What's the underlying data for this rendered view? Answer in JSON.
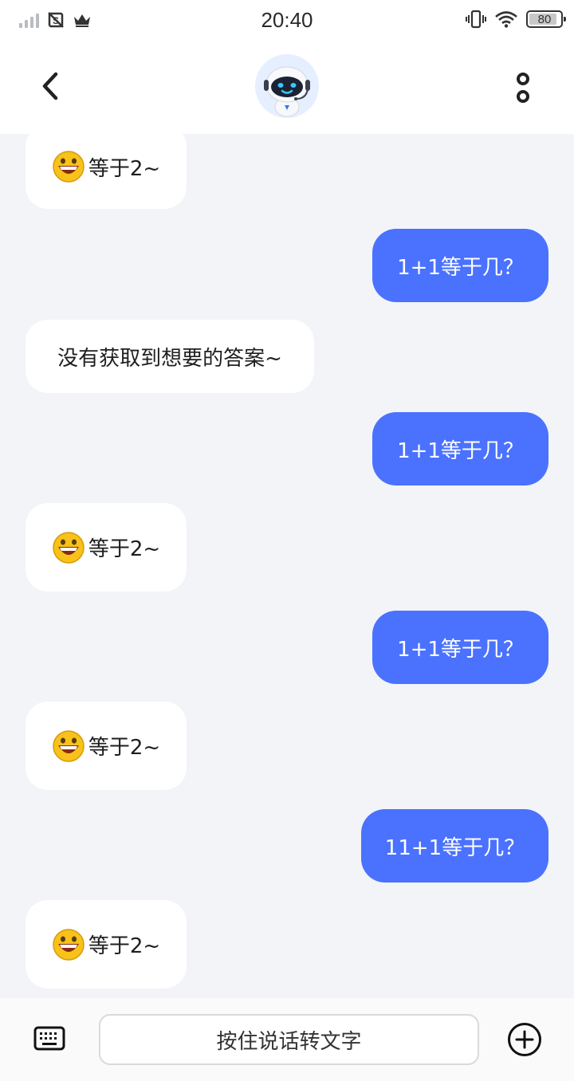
{
  "status_bar": {
    "time": "20:40",
    "battery": "80"
  },
  "header": {
    "avatar_name": "robot-avatar"
  },
  "messages": [
    {
      "role": "bot",
      "emoji": "grinning-face",
      "text": "等于2~"
    },
    {
      "role": "user",
      "text": "1+1等于几？"
    },
    {
      "role": "bot",
      "text": "没有获取到想要的答案~"
    },
    {
      "role": "user",
      "text": "1+1等于几？"
    },
    {
      "role": "bot",
      "emoji": "grinning-face",
      "text": "等于2~"
    },
    {
      "role": "user",
      "text": "1+1等于几？"
    },
    {
      "role": "bot",
      "emoji": "grinning-face",
      "text": "等于2~"
    },
    {
      "role": "user",
      "text": "11+1等于几？"
    },
    {
      "role": "bot",
      "emoji": "grinning-face",
      "text": "等于2~"
    }
  ],
  "input": {
    "voice_label": "按住说话转文字"
  },
  "colors": {
    "user_bubble": "#4a72ff",
    "bot_bubble": "#ffffff",
    "chat_background": "#f2f4f8"
  }
}
